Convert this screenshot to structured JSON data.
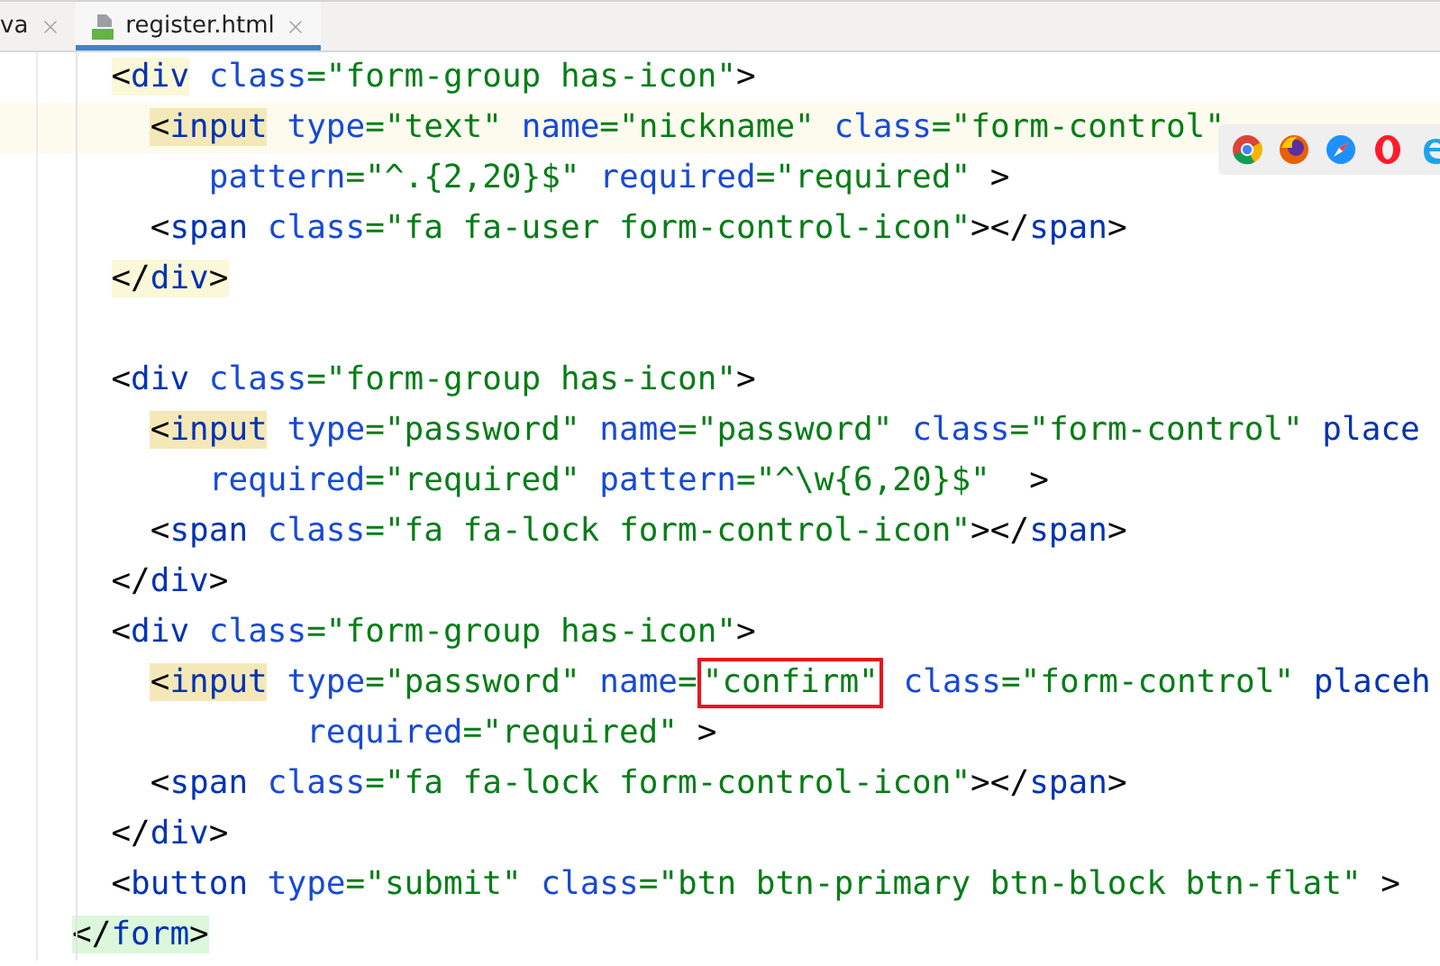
{
  "tabs": [
    {
      "label": "va",
      "selected": false
    },
    {
      "label": "register.html",
      "selected": true
    }
  ],
  "lines": [
    {
      "text": "  <div class=\"form-group has-icon\">",
      "current": false,
      "color": "#fbf8d8"
    },
    {
      "text": "    <input type=\"text\" name=\"nickname\" class=\"form-control\"",
      "current": true,
      "color": "#f5e8b8"
    },
    {
      "text": "       pattern=\"^.{2,20}$\" required=\"required\" >",
      "current": false
    },
    {
      "text": "    <span class=\"fa fa-user form-control-icon\"></span>",
      "current": false
    },
    {
      "text": "  </div>",
      "current": false,
      "color": "#fbf8d8"
    },
    {
      "current": false
    },
    {
      "text": "  <div class=\"form-group has-icon\">",
      "current": false
    },
    {
      "text": "    <input type=\"password\" name=\"password\" class=\"form-control\" place",
      "current": false,
      "color": "#f5e8b8"
    },
    {
      "text": "       required=\"required\" pattern=\"^\\w{6,20}$\"  >",
      "current": false
    },
    {
      "text": "    <span class=\"fa fa-lock form-control-icon\"></span>",
      "current": false
    },
    {
      "text": "  </div>",
      "current": false
    },
    {
      "text": "  <div class=\"form-group has-icon\">",
      "current": false
    },
    {
      "segments": [
        {
          "text": "    <input type=\"password\" name=",
          "boxed": false
        },
        {
          "text": "\"confirm\"",
          "boxed": true
        },
        {
          "text": " class=\"form-control\" placeh",
          "boxed": false
        }
      ],
      "current": false,
      "color": "#f5e8b8"
    },
    {
      "text": "            required=\"required\" >",
      "current": false
    },
    {
      "text": "    <span class=\"fa fa-lock form-control-icon\"></span>",
      "current": false
    },
    {
      "text": "  </div>",
      "current": false
    },
    {
      "text": "  <button type=\"submit\" class=\"btn btn-primary btn-block btn-flat\" >",
      "current": false
    },
    {
      "text": "</form>",
      "current": false,
      "color": "#dcf7dc"
    }
  ]
}
